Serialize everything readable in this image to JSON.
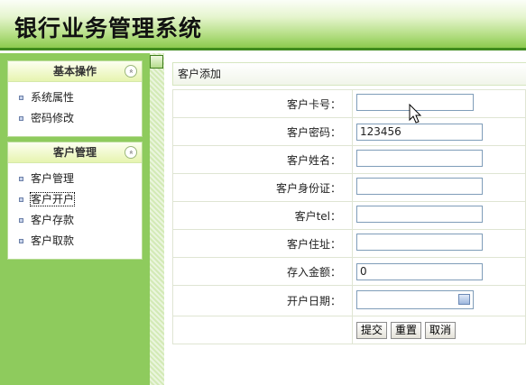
{
  "app": {
    "title": "银行业务管理系统"
  },
  "sidebar": {
    "panels": [
      {
        "title": "基本操作",
        "collapse_icon": "«",
        "items": [
          "系统属性",
          "密码修改"
        ]
      },
      {
        "title": "客户管理",
        "collapse_icon": "«",
        "items": [
          "客户管理",
          "客户开户",
          "客户存款",
          "客户取款"
        ]
      }
    ]
  },
  "main": {
    "breadcrumb": "客户添加",
    "form": {
      "fields": [
        {
          "label": "客户卡号：",
          "value": ""
        },
        {
          "label": "客户密码：",
          "value": "123456"
        },
        {
          "label": "客户姓名：",
          "value": ""
        },
        {
          "label": "客户身份证：",
          "value": ""
        },
        {
          "label": "客户tel：",
          "value": ""
        },
        {
          "label": "客户住址：",
          "value": ""
        },
        {
          "label": "存入金额：",
          "value": "0"
        },
        {
          "label": "开户日期：",
          "value": ""
        }
      ],
      "buttons": {
        "submit": "提交",
        "reset": "重置",
        "cancel": "取消"
      }
    }
  },
  "colors": {
    "header_border": "#3f8b1e",
    "sidebar_bg": "#8ecb5d",
    "panel_header": "#e7f4b0"
  }
}
